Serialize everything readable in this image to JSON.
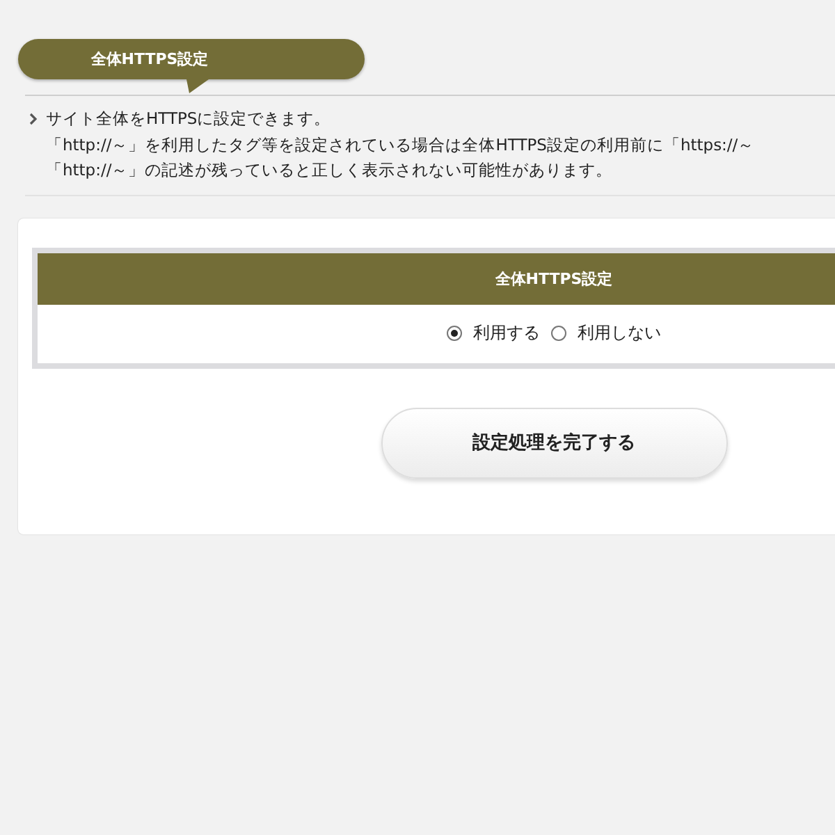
{
  "heading": "全体HTTPS設定",
  "description": [
    "サイト全体をHTTPSに設定できます。",
    "「http://～」を利用したタグ等を設定されている場合は全体HTTPS設定の利用前に「https://～",
    "「http://～」の記述が残っていると正しく表示されない可能性があります。"
  ],
  "table": {
    "header": "全体HTTPS設定",
    "options": [
      {
        "label": "利用する",
        "selected": true
      },
      {
        "label": "利用しない",
        "selected": false
      }
    ]
  },
  "submit_button": "設定処理を完了する"
}
